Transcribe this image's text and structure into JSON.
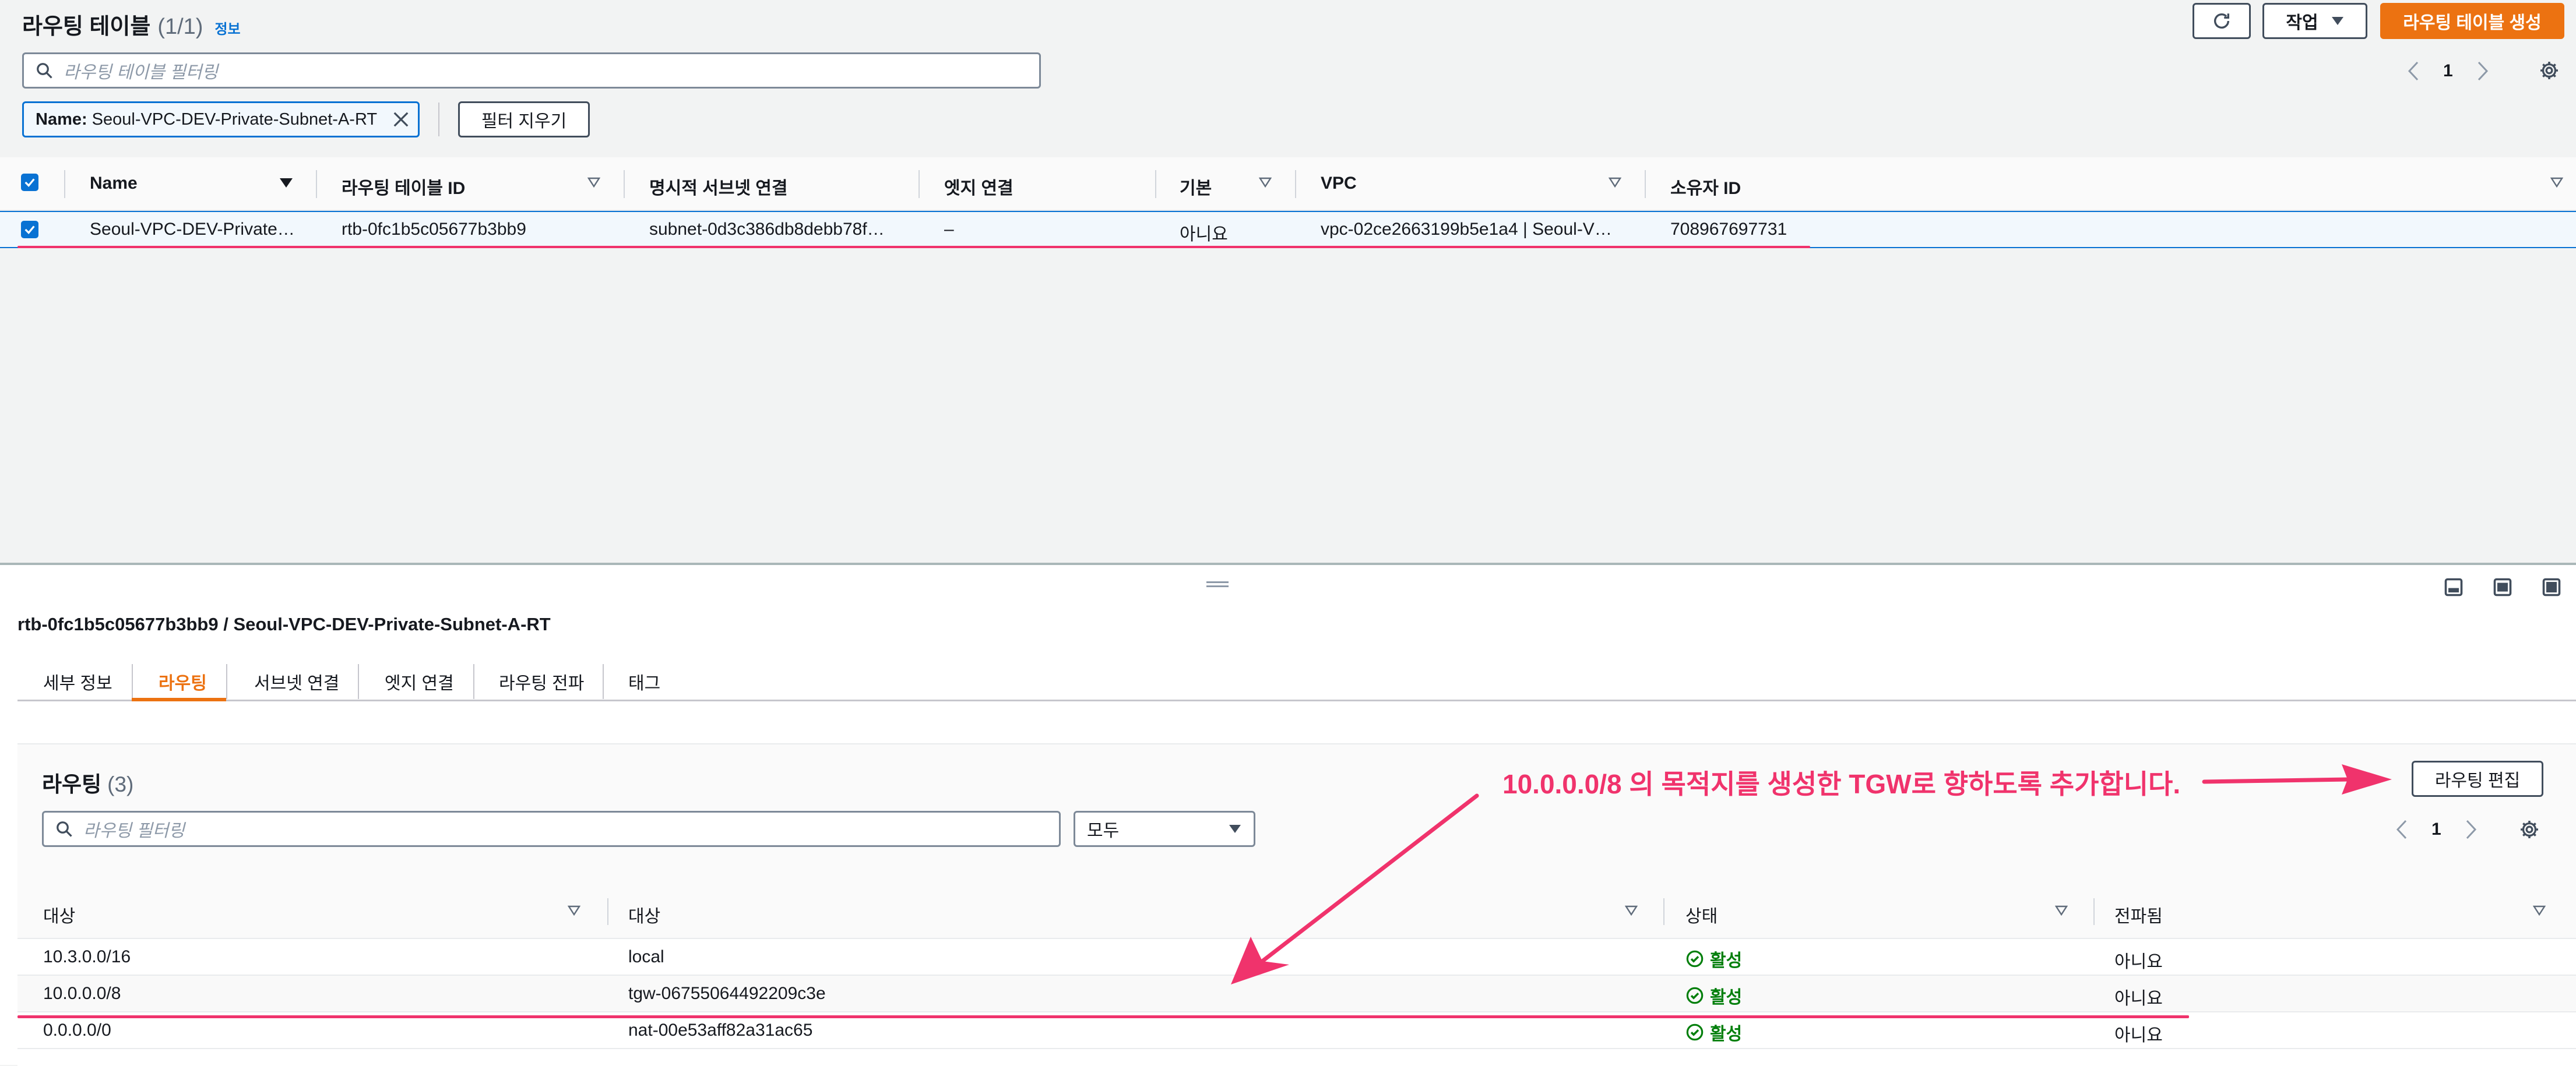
{
  "top": {
    "title": "라우팅 테이블",
    "count": "(1/1)",
    "info": "정보",
    "action_button": "작업",
    "create_button": "라우팅 테이블 생성",
    "filter_placeholder": "라우팅 테이블 필터링",
    "page": "1",
    "filter_token": {
      "key": "Name:",
      "value": "Seoul-VPC-DEV-Private-Subnet-A-RT"
    },
    "clear_filter_button": "필터 지우기",
    "columns": [
      "Name",
      "라우팅 테이블 ID",
      "명시적 서브넷 연결",
      "엣지 연결",
      "기본",
      "VPC",
      "소유자 ID"
    ],
    "row": {
      "name": "Seoul-VPC-DEV-Private…",
      "id": "rtb-0fc1b5c05677b3bb9",
      "subnet": "subnet-0d3c386db8debb78f…",
      "edge": "–",
      "default": "아니요",
      "vpc": "vpc-02ce2663199b5e1a4 | Seoul-V…",
      "owner": "708967697731"
    }
  },
  "detail": {
    "breadcrumb": "rtb-0fc1b5c05677b3bb9 / Seoul-VPC-DEV-Private-Subnet-A-RT",
    "tabs": [
      "세부 정보",
      "라우팅",
      "서브넷 연결",
      "엣지 연결",
      "라우팅 전파",
      "태그"
    ],
    "active_tab": "라우팅",
    "routes_title": "라우팅",
    "routes_count": "(3)",
    "edit_button": "라우팅 편집",
    "filter_placeholder": "라우팅 필터링",
    "select_value": "모두",
    "page": "1",
    "columns": [
      "대상",
      "대상",
      "상태",
      "전파됨"
    ],
    "routes": [
      {
        "destination": "10.3.0.0/16",
        "target": "local",
        "status": "활성",
        "propagated": "아니요",
        "target_link": false
      },
      {
        "destination": "10.0.0.0/8",
        "target": "tgw-06755064492209c3e",
        "status": "활성",
        "propagated": "아니요",
        "target_link": false
      },
      {
        "destination": "0.0.0.0/0",
        "target": "nat-00e53aff82a31ac65",
        "status": "활성",
        "propagated": "아니요",
        "target_link": true
      }
    ]
  },
  "annotation": {
    "text": "10.0.0.0/8 의 목적지를 생성한 TGW로 향하도록 추가합니다.",
    "color": "#f0336c"
  },
  "colors": {
    "primary": "#ec7211",
    "link": "#0972d3",
    "active": "#037f0c",
    "selected_row": "#f2f8fd"
  }
}
